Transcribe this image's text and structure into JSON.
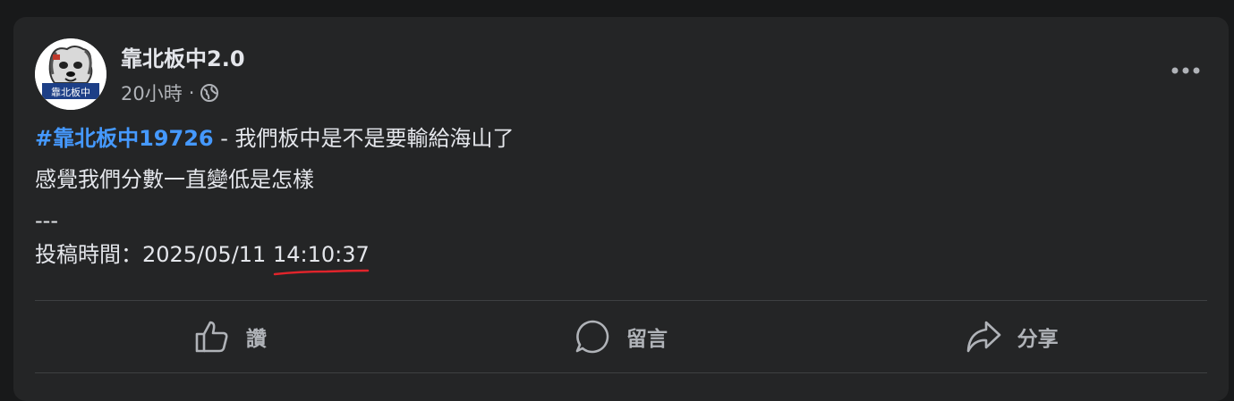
{
  "post": {
    "page_name": "靠北板中2.0",
    "time_ago": "20小時",
    "separator": "·",
    "privacy_icon": "globe-icon",
    "avatar": {
      "logo_text": "靠北板中",
      "icon": "dog-logo"
    },
    "more_icon": "more-horizontal-icon",
    "body": {
      "hashtag": "#靠北板中19726",
      "title_rest": " - 我們板中是不是要輸給海山了",
      "line2": "感覺我們分數一直變低是怎樣",
      "separator_line": "---",
      "submit_label": "投稿時間：",
      "submit_date": "2025/05/11 ",
      "submit_time": "14:10:37"
    },
    "annotation_color": "#e0242b",
    "actions": [
      {
        "label": "讚",
        "icon": "thumbs-up-icon"
      },
      {
        "label": "留言",
        "icon": "comment-icon"
      },
      {
        "label": "分享",
        "icon": "share-icon"
      }
    ]
  }
}
